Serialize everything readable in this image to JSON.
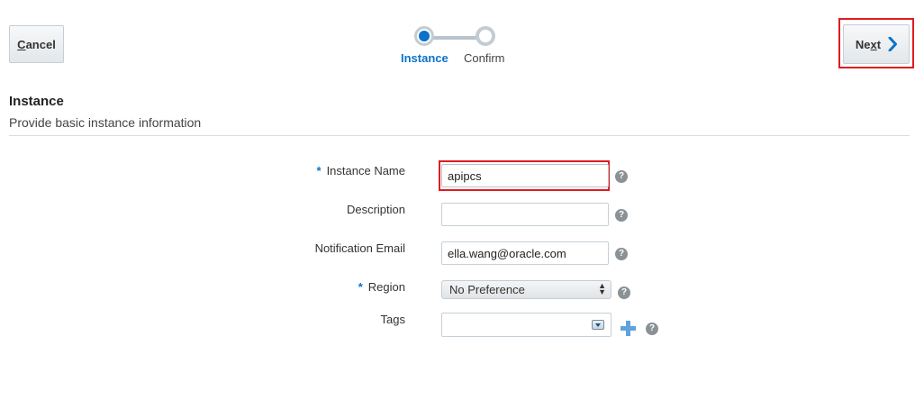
{
  "header": {
    "cancel_label_underlined": "C",
    "cancel_label_rest": "ancel",
    "next_label_start": "Ne",
    "next_label_underlined": "x",
    "next_label_end": "t"
  },
  "train": {
    "steps": [
      {
        "label": "Instance",
        "state": "current"
      },
      {
        "label": "Confirm",
        "state": "pending"
      }
    ]
  },
  "section": {
    "title": "Instance",
    "subtitle": "Provide basic instance information"
  },
  "form": {
    "required_marker": "*",
    "instance_name": {
      "label": "Instance Name",
      "value": "apipcs",
      "required": true
    },
    "description": {
      "label": "Description",
      "value": ""
    },
    "notification_email": {
      "label": "Notification Email",
      "value": "ella.wang@oracle.com"
    },
    "region": {
      "label": "Region",
      "value": "No Preference",
      "required": true
    },
    "tags": {
      "label": "Tags",
      "value": ""
    },
    "help_glyph": "?"
  },
  "colors": {
    "accent": "#0d72c9",
    "highlight": "#e01b22"
  },
  "icons": {
    "next": "chevron-right-icon",
    "help": "help-icon",
    "add": "plus-icon",
    "dropdown": "dropdown-arrow-icon"
  }
}
